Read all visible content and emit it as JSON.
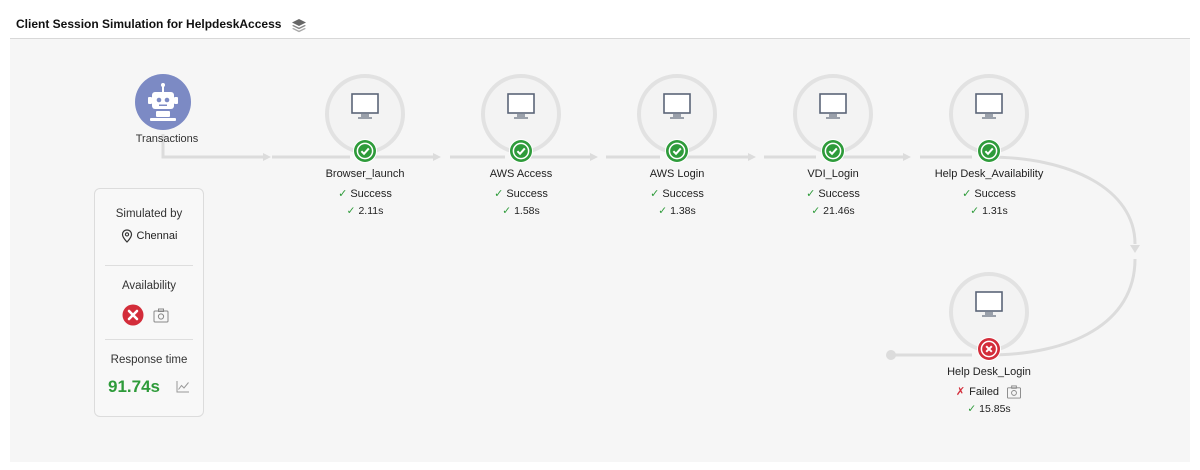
{
  "header": {
    "title": "Client Session Simulation for HelpdeskAccess",
    "icon": "layers-icon"
  },
  "start": {
    "label": "Transactions",
    "icon": "robot-icon",
    "color": "#7c8ac4"
  },
  "info": {
    "simulated_by_label": "Simulated by",
    "location": "Chennai",
    "availability_label": "Availability",
    "availability_state": "failed",
    "response_label": "Response time",
    "response_value": "91.74s"
  },
  "steps": [
    {
      "name": "Browser_launch",
      "status": "Success",
      "time": "2.11s",
      "state": "ok"
    },
    {
      "name": "AWS Access",
      "status": "Success",
      "time": "1.58s",
      "state": "ok"
    },
    {
      "name": "AWS Login",
      "status": "Success",
      "time": "1.38s",
      "state": "ok"
    },
    {
      "name": "VDI_Login",
      "status": "Success",
      "time": "21.46s",
      "state": "ok"
    },
    {
      "name": "Help Desk_Availability",
      "status": "Success",
      "time": "1.31s",
      "state": "ok"
    },
    {
      "name": "Help Desk_Login",
      "status": "Failed",
      "time": "15.85s",
      "state": "failed"
    }
  ],
  "colors": {
    "success": "#2e9b3a",
    "failed": "#d32d3a",
    "robot": "#7c8ac4",
    "connector": "#dcdcdc"
  }
}
